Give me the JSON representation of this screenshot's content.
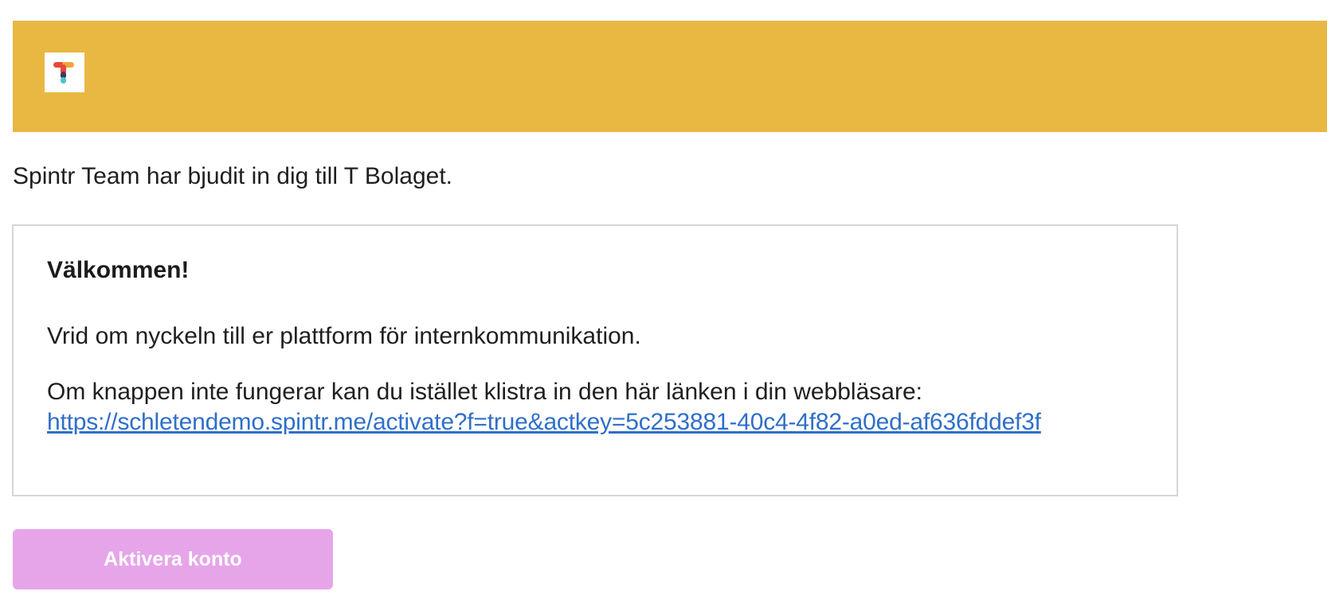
{
  "header": {
    "background_color": "#e9b843",
    "logo": {
      "icon": "spintr-t-logo-icon",
      "colors": [
        "#e8473c",
        "#f2a53a",
        "#3a3f56",
        "#4cc3c7"
      ]
    }
  },
  "intro_text": "Spintr Team har bjudit in dig till T Bolaget.",
  "card": {
    "title": "Välkommen!",
    "lead": "Vrid om nyckeln till er plattform för internkommunikation.",
    "fallback_text": "Om knappen inte fungerar kan du istället klistra in den här länken i din webbläsare:",
    "link_text": "https://schletendemo.spintr.me/activate?f=true&actkey=5c253881-40c4-4f82-a0ed-af636fddef3f",
    "link_color": "#2f6fc9"
  },
  "button": {
    "label": "Aktivera konto",
    "color": "#e6a5e9"
  }
}
